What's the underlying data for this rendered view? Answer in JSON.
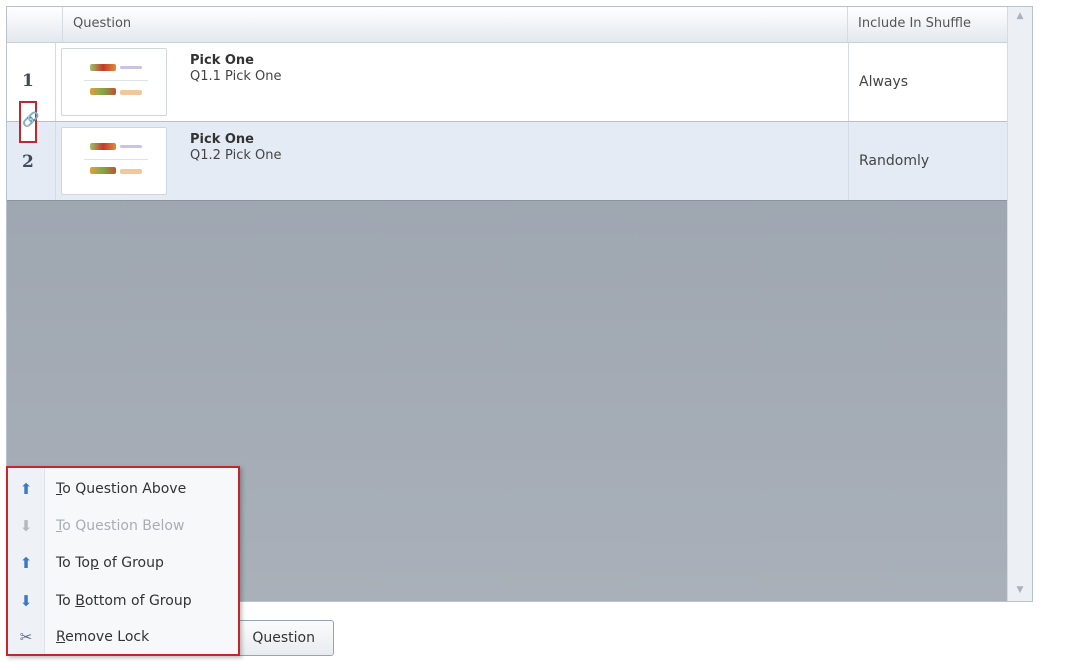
{
  "grid": {
    "columns": {
      "question": "Question",
      "include_in_shuffle": "Include In Shuffle"
    },
    "rows": [
      {
        "number": "1",
        "title": "Pick One",
        "subtitle": "Q1.1 Pick One",
        "shuffle": "Always"
      },
      {
        "number": "2",
        "title": "Pick One",
        "subtitle": "Q1.2 Pick One",
        "shuffle": "Randomly"
      }
    ],
    "scroll_up_icon": "scroll-up-arrow-icon",
    "scroll_down_icon": "scroll-down-arrow-icon"
  },
  "lock_icon": "chain-link-icon",
  "behind_button": {
    "label": "Question"
  },
  "context_menu": {
    "items": [
      {
        "pre": "",
        "hot": "T",
        "post": "o Question Above",
        "icon": "move-up-icon",
        "enabled": true
      },
      {
        "pre": "",
        "hot": "T",
        "post": "o Question Below",
        "icon": "move-down-icon",
        "enabled": false
      },
      {
        "pre": "To To",
        "hot": "p",
        "post": " of Group",
        "icon": "move-top-icon",
        "enabled": true
      },
      {
        "pre": "To ",
        "hot": "B",
        "post": "ottom of Group",
        "icon": "move-bottom-icon",
        "enabled": true
      },
      {
        "pre": "",
        "hot": "R",
        "post": "emove Lock",
        "icon": "unlock-icon",
        "enabled": true
      }
    ]
  },
  "colors": {
    "highlight_border": "#c0282d",
    "selected_row": "#e4ebf5",
    "grid_background": "#a3aab4"
  }
}
